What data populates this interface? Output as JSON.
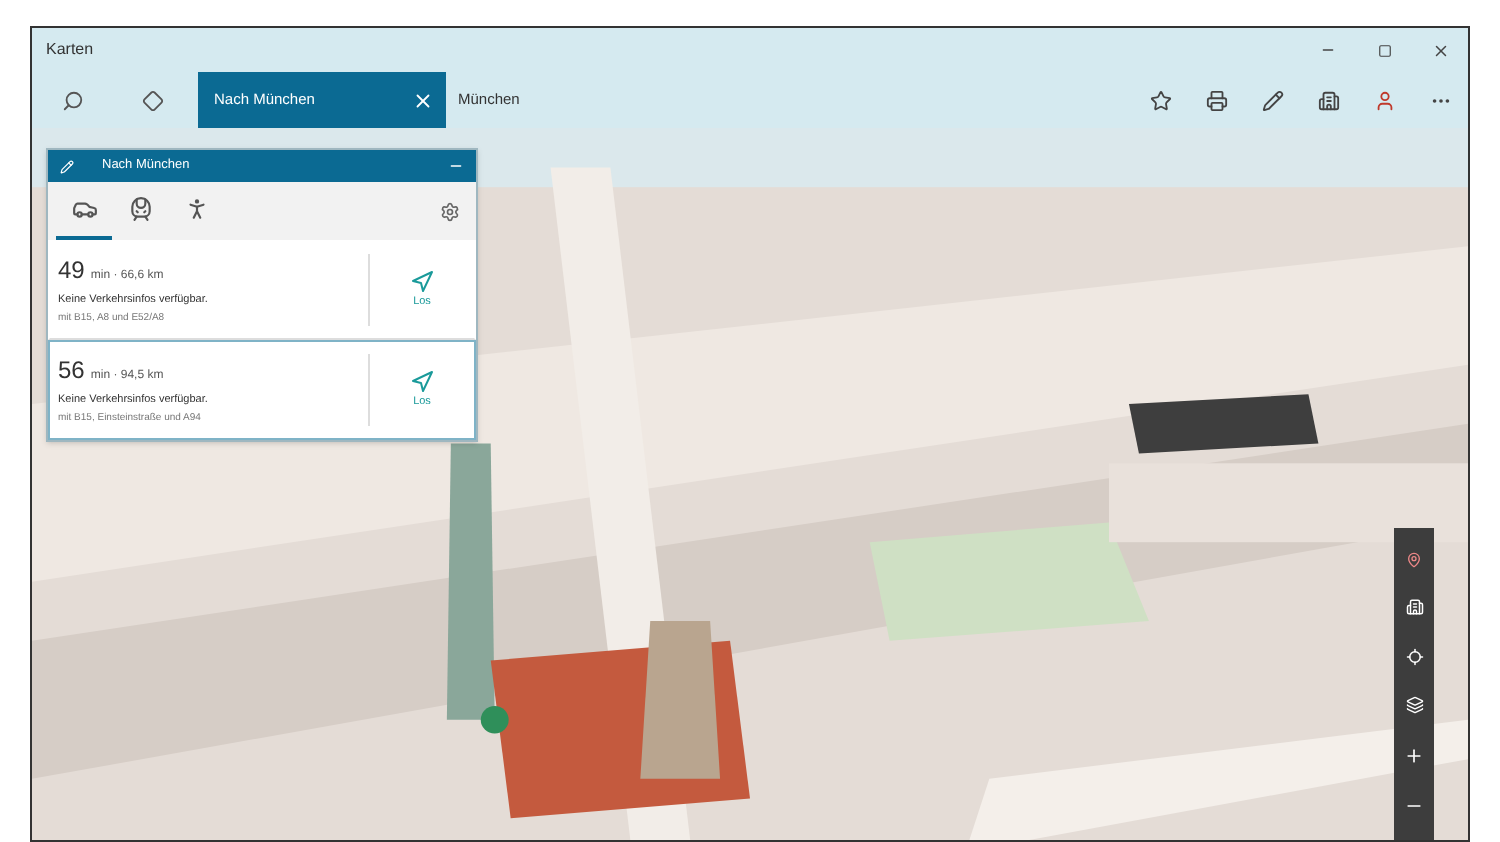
{
  "window": {
    "title": "Karten"
  },
  "toolbar": {
    "tab": {
      "label": "Nach München"
    },
    "query": "München"
  },
  "route_panel": {
    "title": "Nach München",
    "modes": [
      {
        "kind": "car",
        "selected": true
      },
      {
        "kind": "transit",
        "selected": false
      },
      {
        "kind": "walk",
        "selected": false
      }
    ],
    "routes": [
      {
        "duration": "49",
        "details": "min · 66,6 km",
        "traffic": "Keine Verkehrsinfos verfügbar.",
        "via": "mit B15, A8 und E52/A8",
        "go_label": "Los",
        "selected": false
      },
      {
        "duration": "56",
        "details": "min · 94,5 km",
        "traffic": "Keine Verkehrsinfos verfügbar.",
        "via": "mit B15, Einsteinstraße und A94",
        "go_label": "Los",
        "selected": true
      }
    ]
  }
}
